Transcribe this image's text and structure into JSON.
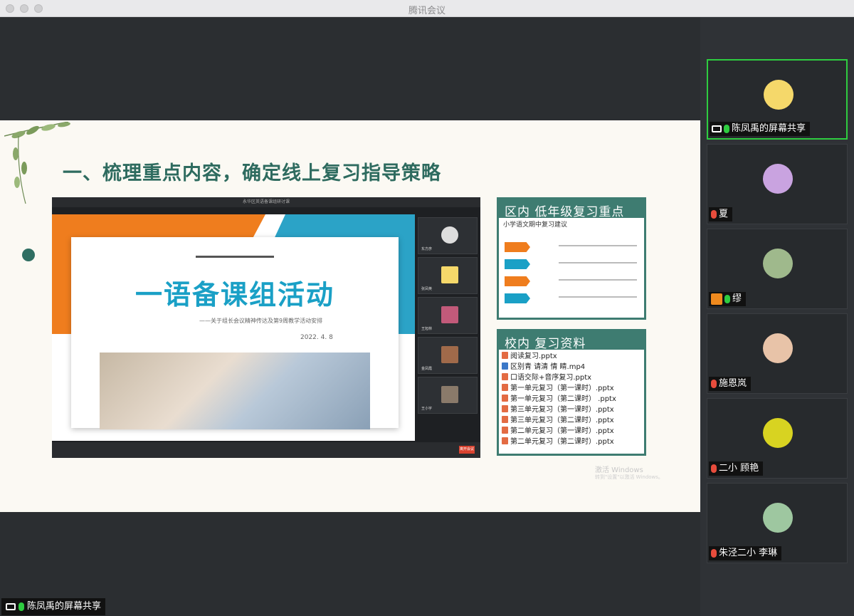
{
  "app": {
    "title": "腾讯会议"
  },
  "slide": {
    "heading": "一、梳理重点内容，确定线上复习指导策略",
    "embedded": {
      "window_title": "永华区英语备课组研讨课",
      "big_title": "一语备课组活动",
      "subtitle": "——关于组长会议精神传达及第9周教学活动安排",
      "date": "2022. 4. 8",
      "end_button": "离开会议",
      "thumb_names": [
        "东方彦",
        "张凤英",
        "王旭林",
        "金凤霞",
        "王小宇"
      ]
    },
    "panel1": {
      "header": "区内  低年级复习重点",
      "subtitle": "小学语文期中复习建议",
      "colors": [
        "#ef7d1e",
        "#1aa0c6",
        "#ef7d1e",
        "#1aa0c6"
      ]
    },
    "panel2": {
      "header": "校内  复习资料",
      "files": [
        {
          "name": "阅读复习.pptx",
          "type": "ppt"
        },
        {
          "name": "区别青 请清 情 睛.mp4",
          "type": "video"
        },
        {
          "name": "口语交际+音序复习.pptx",
          "type": "ppt"
        },
        {
          "name": "第一单元复习（第一课时）.pptx",
          "type": "ppt"
        },
        {
          "name": "第一单元复习（第二课时） .pptx",
          "type": "ppt"
        },
        {
          "name": "第三单元复习（第一课时）.pptx",
          "type": "ppt"
        },
        {
          "name": "第三单元复习（第二课时）.pptx",
          "type": "ppt"
        },
        {
          "name": "第二单元复习（第一课时）.pptx",
          "type": "ppt"
        },
        {
          "name": "第二单元复习（第二课时）.pptx",
          "type": "ppt"
        }
      ]
    },
    "watermark": "激活 Windows",
    "watermark_sub": "转到\"设置\"以激活 Windows。"
  },
  "share_label": "陈凤禹的屏幕共享",
  "participants": [
    {
      "name": "陈凤禹的屏幕共享",
      "mic": "on",
      "screen": true,
      "active": true,
      "avatar": "#f5d86a"
    },
    {
      "name": "夏",
      "mic": "off",
      "avatar": "#c9a3e0"
    },
    {
      "name": "缪",
      "mic": "on",
      "host": true,
      "avatar": "#9fb98c"
    },
    {
      "name": "施恩岚",
      "mic": "off",
      "avatar": "#e8c3a8"
    },
    {
      "name": "二小  顾艳",
      "mic": "off",
      "avatar": "#d8d321"
    },
    {
      "name": "朱泾二小 李琳",
      "mic": "off",
      "avatar": "#9ec7a0"
    }
  ]
}
